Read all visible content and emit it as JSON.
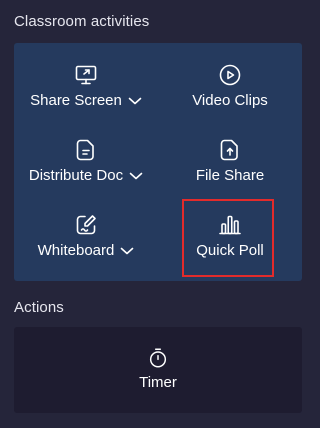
{
  "sections": {
    "activities_title": "Classroom activities",
    "actions_title": "Actions"
  },
  "activities": [
    {
      "label": "Share Screen",
      "icon": "share-screen-icon",
      "has_dropdown": true
    },
    {
      "label": "Video Clips",
      "icon": "video-clips-icon",
      "has_dropdown": false
    },
    {
      "label": "Distribute Doc",
      "icon": "distribute-doc-icon",
      "has_dropdown": true
    },
    {
      "label": "File Share",
      "icon": "file-share-icon",
      "has_dropdown": false
    },
    {
      "label": "Whiteboard",
      "icon": "whiteboard-icon",
      "has_dropdown": true
    },
    {
      "label": "Quick Poll",
      "icon": "quick-poll-icon",
      "has_dropdown": false,
      "highlighted": true
    }
  ],
  "actions": [
    {
      "label": "Timer",
      "icon": "timer-icon"
    }
  ],
  "colors": {
    "background": "#25253a",
    "activities_card": "#253a5e",
    "actions_card": "#1e1c30",
    "highlight": "#e32b2b"
  }
}
